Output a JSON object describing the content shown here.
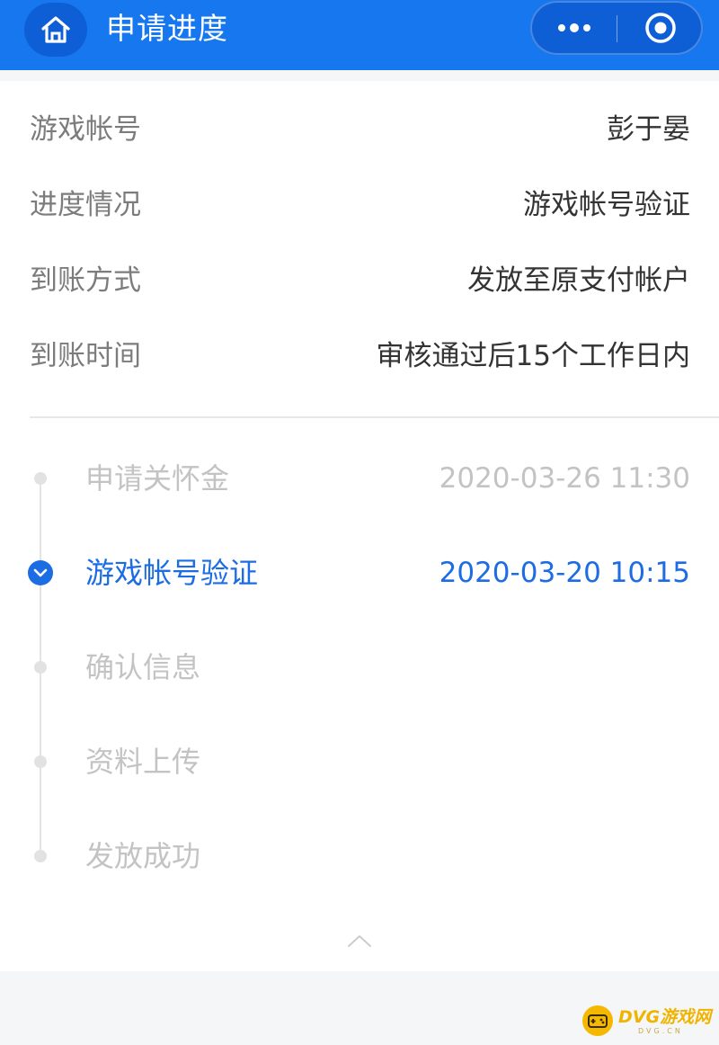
{
  "header": {
    "title": "申请进度",
    "home_icon": "home-icon",
    "more_icon": "more-dots-icon",
    "close_icon": "target-close-icon",
    "bg_color": "#1677ee"
  },
  "info": [
    {
      "label": "游戏帐号",
      "value": "彭于晏"
    },
    {
      "label": "进度情况",
      "value": "游戏帐号验证"
    },
    {
      "label": "到账方式",
      "value": "发放至原支付帐户"
    },
    {
      "label": "到账时间",
      "value": "审核通过后15个工作日内"
    }
  ],
  "timeline": [
    {
      "label": "申请关怀金",
      "time": "2020-03-26 11:30",
      "state": "done"
    },
    {
      "label": "游戏帐号验证",
      "time": "2020-03-20 10:15",
      "state": "active"
    },
    {
      "label": "确认信息",
      "time": "",
      "state": "pending"
    },
    {
      "label": "资料上传",
      "time": "",
      "state": "pending"
    },
    {
      "label": "发放成功",
      "time": "",
      "state": "pending"
    }
  ],
  "accent_color": "#1c6ce3",
  "collapse_icon": "chevron-up-icon",
  "watermark": {
    "text": "DVG游戏网",
    "sub": "DVG.CN"
  }
}
